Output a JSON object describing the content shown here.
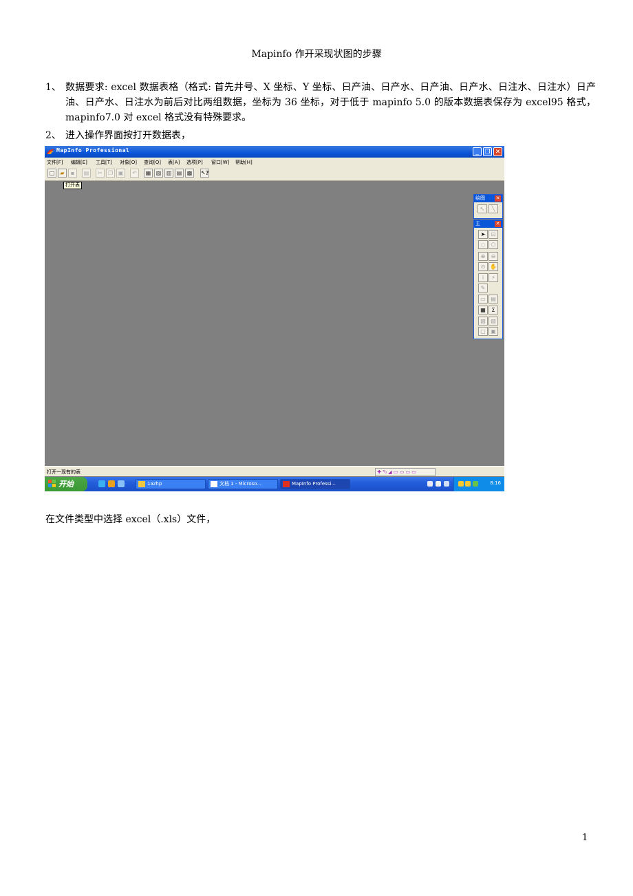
{
  "document": {
    "title": "Mapinfo 作开采现状图的步骤",
    "items": [
      {
        "number": "1、",
        "text": "数据要求: excel 数据表格（格式: 首先井号、X 坐标、Y 坐标、日产油、日产水、日产油、日产水、日注水、日注水）日产油、日产水、日注水为前后对比两组数据，坐标为 36 坐标，对于低于 mapinfo 5.0 的版本数据表保存为 excel95 格式，mapinfo7.0 对 excel 格式没有特殊要求。"
      },
      {
        "number": "2、",
        "text": "进入操作界面按打开数据表，"
      }
    ],
    "paragraph": "在文件类型中选择 excel（.xls）文件，",
    "page_number": "1"
  },
  "screenshot": {
    "window_title": "MapInfo Professional",
    "menu": [
      "文件[F]",
      "编辑[E]",
      "工具[T]",
      "对象[O]",
      "查询[Q]",
      "表[A]",
      "选项[P]",
      "窗口[W]",
      "帮助[H]"
    ],
    "tooltip": "打开表",
    "draw_palette_title": "绘图",
    "main_palette_title": "主",
    "status": "打开一现有的表",
    "start_label": "开始",
    "tasks": [
      "1azhp",
      "文档 1 - Microso...",
      "MapInfo Professi..."
    ],
    "clock": "8:16",
    "colors": {
      "titlebar": "#0a56d8",
      "workspace": "#808080",
      "taskbar": "#245edb",
      "start": "#3a9a34"
    }
  }
}
